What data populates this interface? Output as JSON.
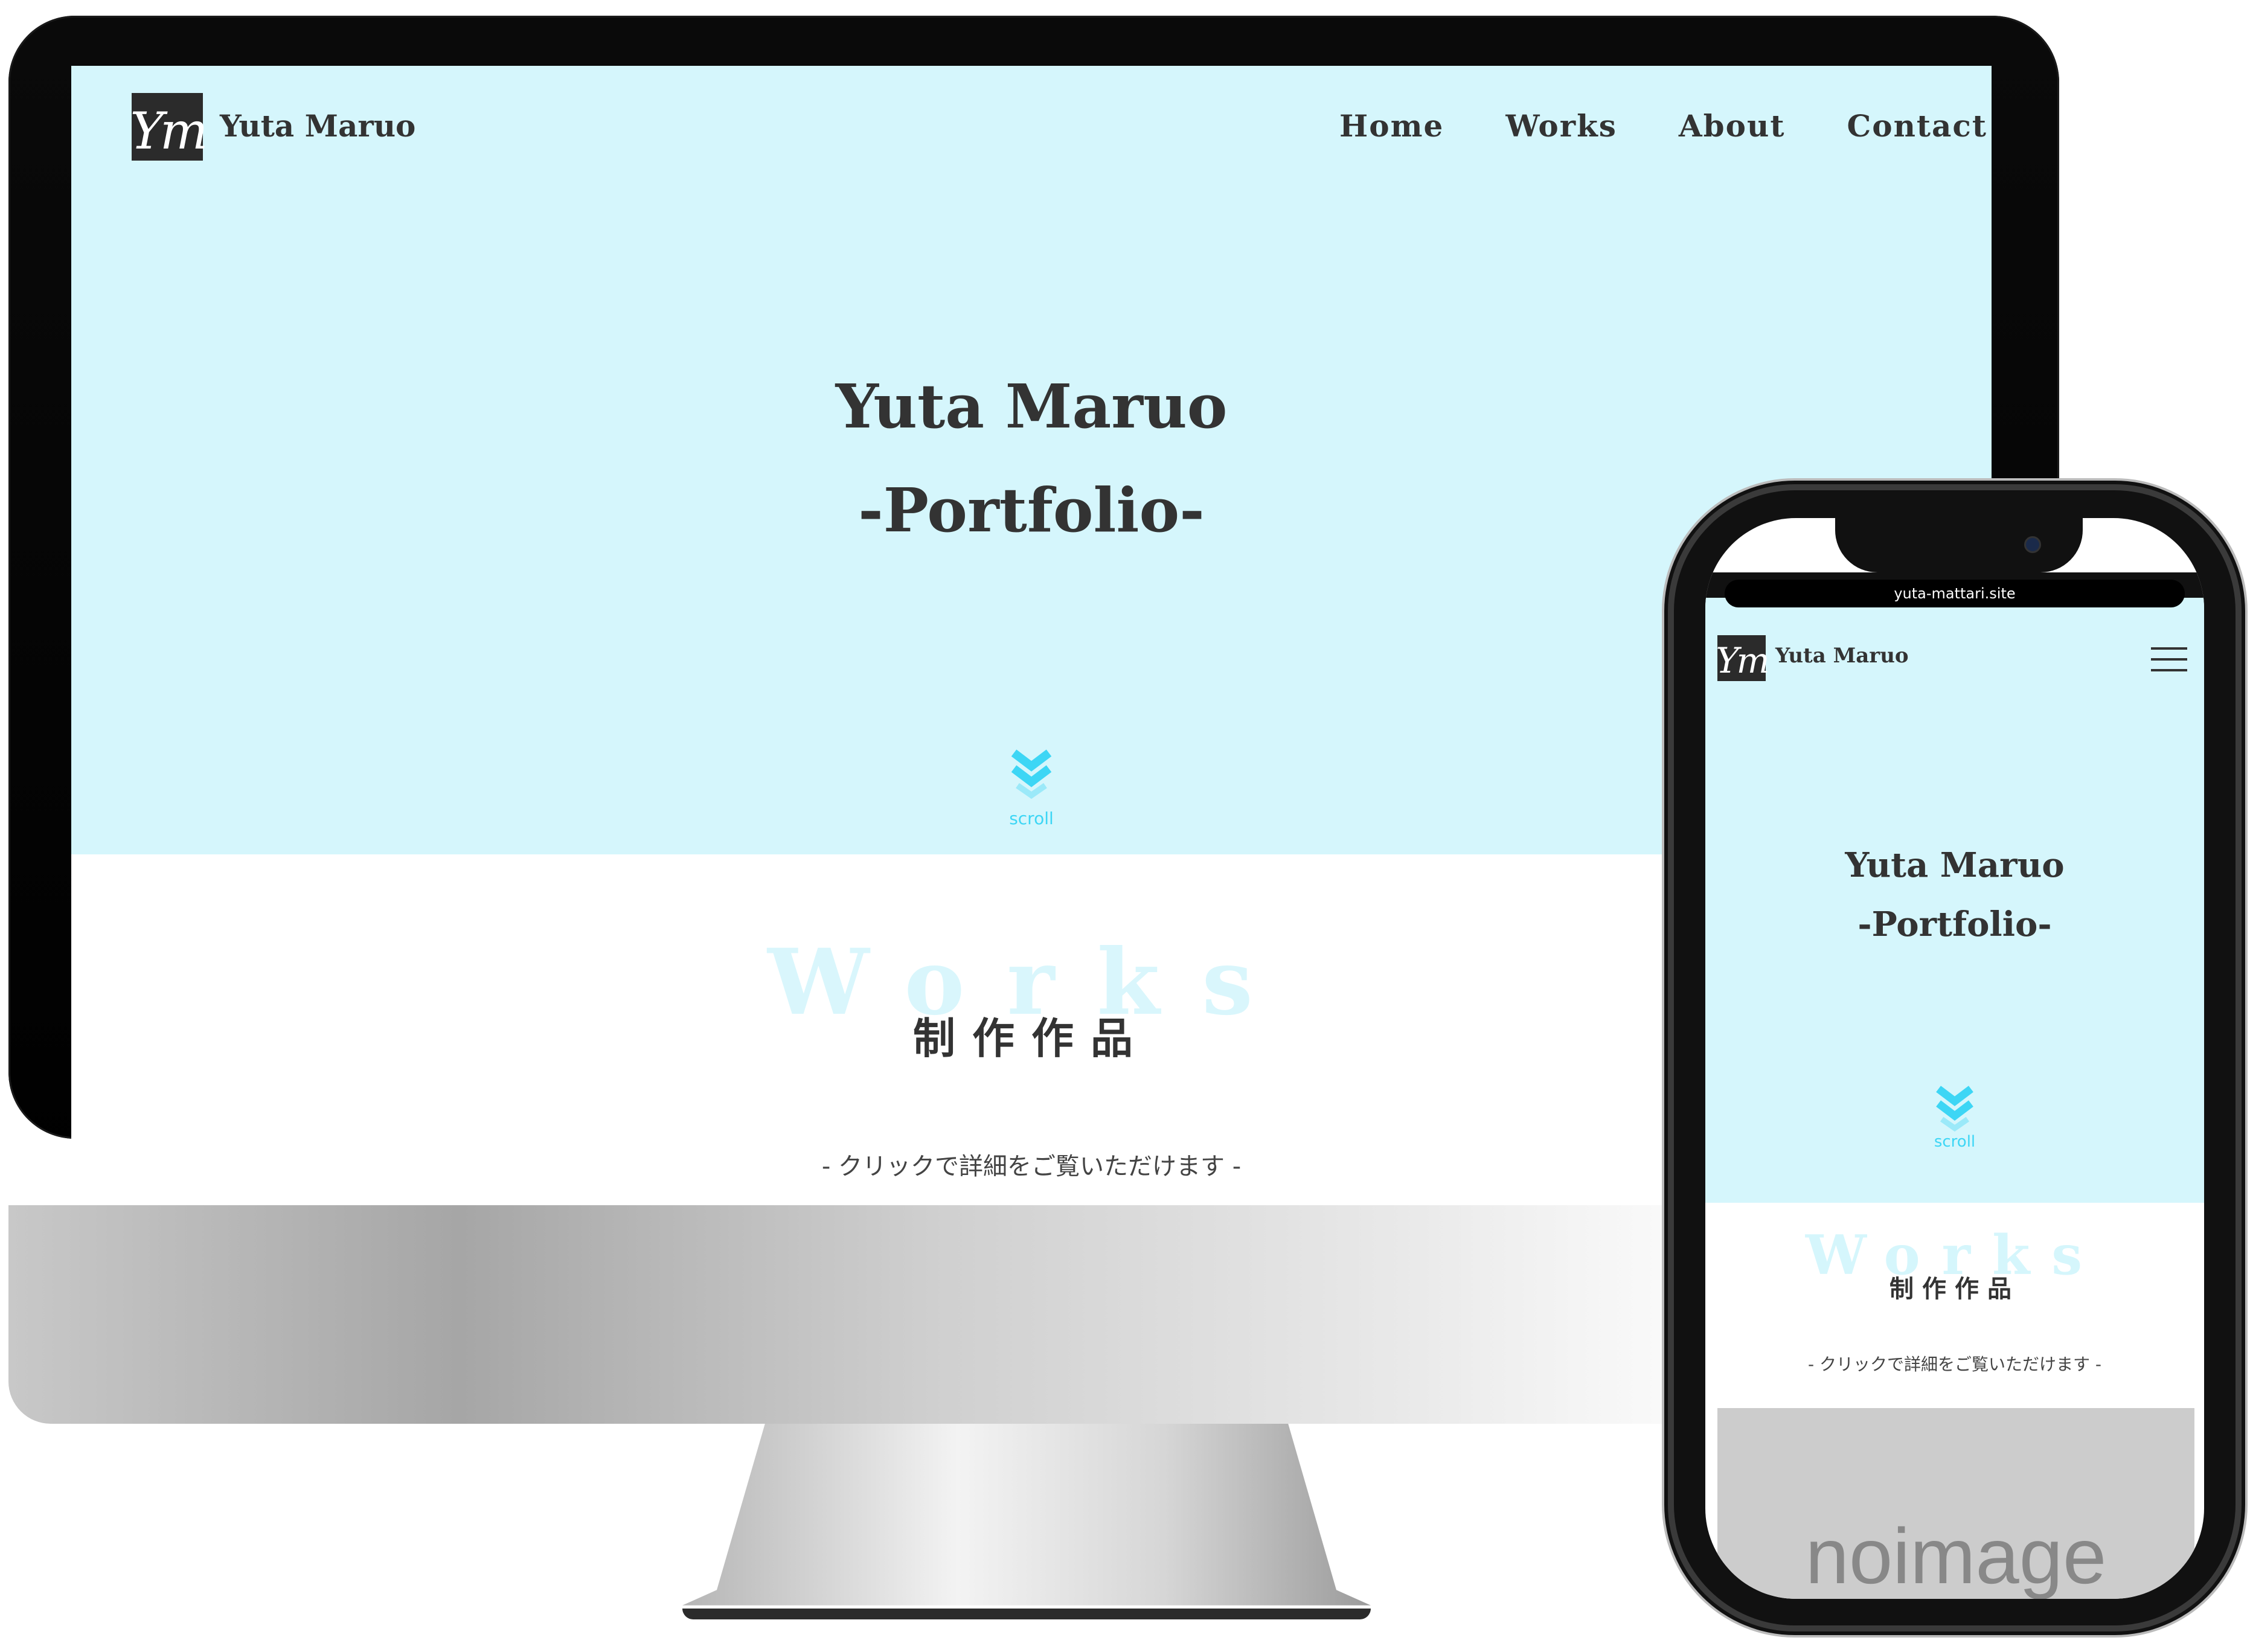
{
  "desktop": {
    "brand": "Yuta Maruo",
    "logo_text": "Ym",
    "nav": [
      "Home",
      "Works",
      "About",
      "Contact"
    ],
    "hero_title_line1": "Yuta Maruo",
    "hero_title_line2": "-Portfolio-",
    "scroll_label": "scroll",
    "works_bg_text": "Works",
    "works_heading": "制作作品",
    "works_subtitle": "- クリックで詳細をご覧いただけます -"
  },
  "phone": {
    "url": "yuta-mattari.site",
    "brand": "Yuta Maruo",
    "logo_text": "Ym",
    "hero_title_line1": "Yuta Maruo",
    "hero_title_line2": "-Portfolio-",
    "scroll_label": "scroll",
    "works_bg_text": "Works",
    "works_heading": "制作作品",
    "works_subtitle": "- クリックで詳細をご覧いただけます -",
    "placeholder_image_text": "noimage"
  },
  "colors": {
    "hero_bg": "#d5f6fc",
    "accent_cyan": "#3dd6f5",
    "text_dark": "#333333"
  },
  "icons": [
    "logo-icon",
    "chevron-double-down-icon",
    "hamburger-menu-icon"
  ]
}
